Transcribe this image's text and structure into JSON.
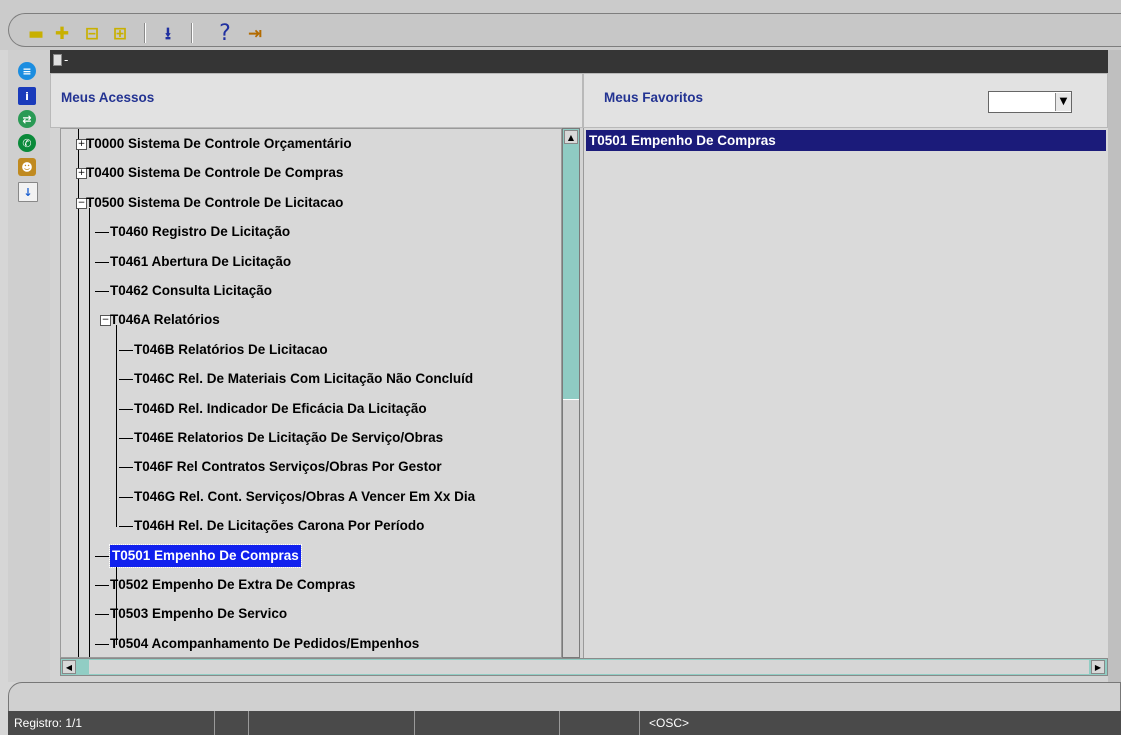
{
  "window": {
    "title": "-"
  },
  "left_pane": {
    "header": "Meus Acessos"
  },
  "right_pane": {
    "header": "Meus Favoritos",
    "dropdown_value": ""
  },
  "tree": [
    {
      "label": "T0000  Sistema De Controle Orçamentário",
      "state": "collapsed"
    },
    {
      "label": "T0400  Sistema De Controle De Compras",
      "state": "collapsed"
    },
    {
      "label": "T0500  Sistema De Controle De Licitacao",
      "state": "expanded"
    },
    {
      "label": "T0460  Registro De Licitação"
    },
    {
      "label": "T0461  Abertura De Licitação"
    },
    {
      "label": "T0462  Consulta Licitação"
    },
    {
      "label": "T046A  Relatórios",
      "state": "expanded"
    },
    {
      "label": "T046B  Relatórios De Licitacao"
    },
    {
      "label": "T046C  Rel. De Materiais Com Licitação Não Concluíd"
    },
    {
      "label": "T046D  Rel. Indicador De Eficácia Da Licitação"
    },
    {
      "label": "T046E  Relatorios De Licitação De Serviço/Obras"
    },
    {
      "label": "T046F  Rel Contratos Serviços/Obras Por Gestor"
    },
    {
      "label": "T046G  Rel. Cont. Serviços/Obras A Vencer Em Xx Dia"
    },
    {
      "label": "T046H  Rel. De Licitações Carona Por Período"
    },
    {
      "label": "T0501  Empenho De Compras",
      "selected": true
    },
    {
      "label": "T0502  Empenho De Extra De Compras"
    },
    {
      "label": "T0503  Empenho De Servico"
    },
    {
      "label": "T0504  Acompanhamento De Pedidos/Empenhos"
    }
  ],
  "favorites": [
    "T0501 Empenho De Compras"
  ],
  "toolbar": {
    "buttons": [
      "remove-icon",
      "add-icon",
      "remove-item-icon",
      "add-all-icon",
      "download-icon",
      "help-icon",
      "exit-icon"
    ],
    "help_glyph": "?"
  },
  "statusbar": {
    "record": "Registro: 1/1",
    "mode": "<OSC>"
  },
  "colors": {
    "selection": "#1020ee",
    "favorite_selection": "#1b1b7a",
    "header_text": "#233392",
    "scrollbar": "#8fcbc3"
  }
}
